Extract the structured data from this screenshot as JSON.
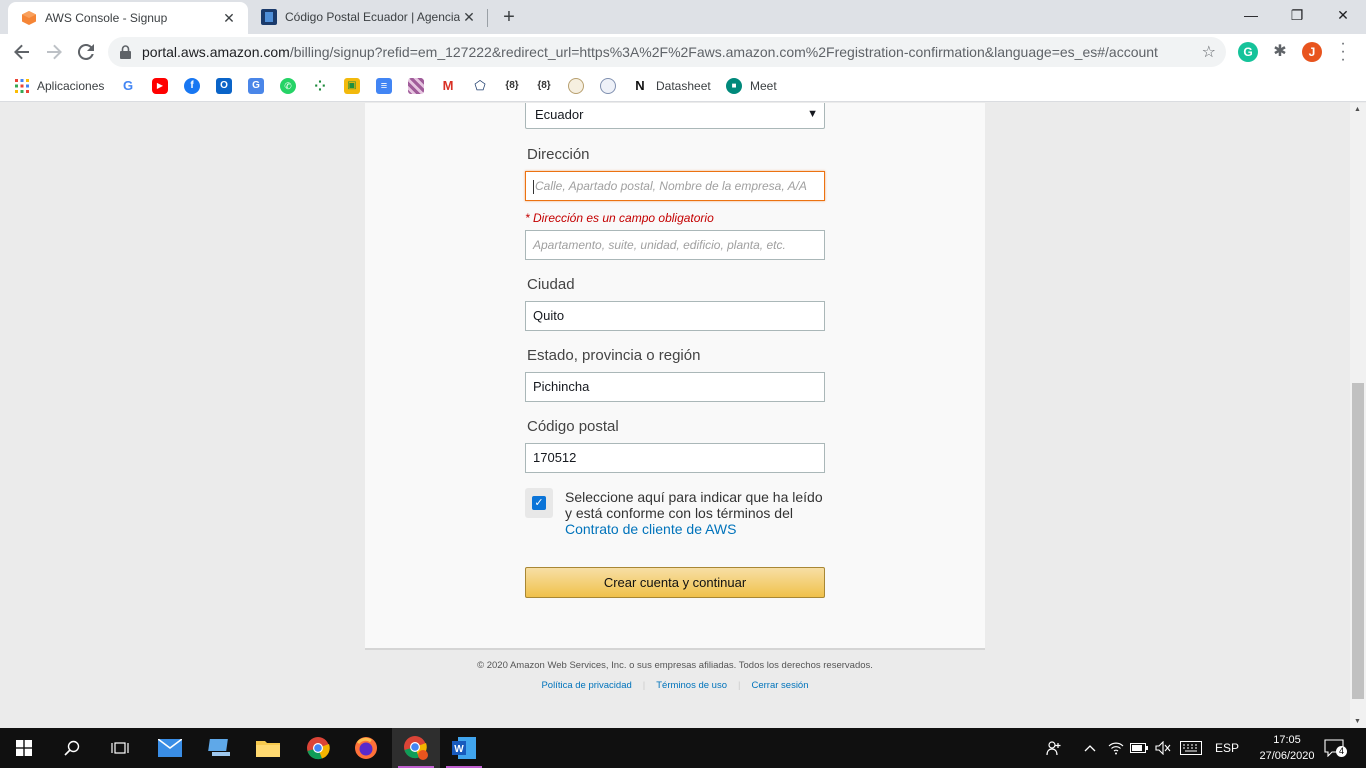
{
  "browser": {
    "tabs": [
      {
        "title": "AWS Console - Signup",
        "active": true
      },
      {
        "title": "Código Postal Ecuador | Agencia",
        "active": false
      }
    ],
    "close_glyph": "✕",
    "new_tab_glyph": "+",
    "window_controls": {
      "minimize": "—",
      "maximize": "❐",
      "close": "✕"
    },
    "url_host": "portal.aws.amazon.com",
    "url_path": "/billing/signup?refid=em_127222&redirect_url=https%3A%2F%2Faws.amazon.com%2Fregistration-confirmation&language=es_es#/account",
    "profile_initial": "J",
    "bookmarks": [
      {
        "label": "Aplicaciones",
        "icon": "apps-grid-icon"
      },
      {
        "label": "",
        "icon": "google-icon",
        "letter": "G",
        "color": "#ffffff"
      },
      {
        "label": "",
        "icon": "youtube-icon",
        "color": "#ff0000"
      },
      {
        "label": "",
        "icon": "facebook-icon",
        "letter": "f",
        "color": "#1877f2"
      },
      {
        "label": "",
        "icon": "outlook-icon",
        "letter": "O",
        "color": "#0a64c8"
      },
      {
        "label": "",
        "icon": "translate-icon",
        "letter": "G",
        "color": "#4a86e8"
      },
      {
        "label": "",
        "icon": "whatsapp-icon",
        "color": "#25d366"
      },
      {
        "label": "",
        "icon": "dots-app-icon",
        "color": "#1b8a3a"
      },
      {
        "label": "",
        "icon": "classroom-icon",
        "color": "#f2b90c"
      },
      {
        "label": "",
        "icon": "docs-icon",
        "color": "#4285f4"
      },
      {
        "label": "",
        "icon": "pattern-icon",
        "color": "#a05c9a"
      },
      {
        "label": "",
        "icon": "gmail-icon",
        "letter": "M",
        "color": "#ffffff"
      },
      {
        "label": "",
        "icon": "pentagon-icon",
        "color": "#ffffff"
      },
      {
        "label": "",
        "icon": "brackets-icon",
        "color": "#ffffff"
      },
      {
        "label": "",
        "icon": "brackets-icon-2",
        "color": "#ffffff"
      },
      {
        "label": "",
        "icon": "seal-icon",
        "color": "#ffffff"
      },
      {
        "label": "",
        "icon": "seal-icon-2",
        "color": "#ffffff"
      },
      {
        "label": "Datasheet",
        "icon": "datasheet-icon"
      },
      {
        "label": "Meet",
        "icon": "meet-icon"
      }
    ]
  },
  "form": {
    "country_value": "Ecuador",
    "address_label": "Dirección",
    "address_placeholder": "Calle, Apartado postal, Nombre de la empresa, A/A",
    "address_error": "* Dirección es un campo obligatorio",
    "address2_placeholder": "Apartamento, suite, unidad, edificio, planta, etc.",
    "city_label": "Ciudad",
    "city_value": "Quito",
    "state_label": "Estado, provincia o región",
    "state_value": "Pichincha",
    "postal_label": "Código postal",
    "postal_value": "170512",
    "agree_checked": true,
    "agree_text": "Seleccione aquí para indicar que ha leído y está conforme con los términos del",
    "agree_link": "Contrato de cliente de AWS",
    "submit_label": "Crear cuenta y continuar"
  },
  "footer": {
    "copyright": "© 2020 Amazon Web Services, Inc. o sus empresas afiliadas. Todos los derechos reservados.",
    "links": [
      "Política de privacidad",
      "Términos de uso",
      "Cerrar sesión"
    ]
  },
  "taskbar": {
    "language": "ESP",
    "time": "17:05",
    "date": "27/06/2020",
    "notification_count": "4"
  },
  "colors": {
    "accent_orange": "#ec7211",
    "link_blue": "#0073bb",
    "error_red": "#c40000",
    "checkbox_blue": "#0b74d8"
  }
}
